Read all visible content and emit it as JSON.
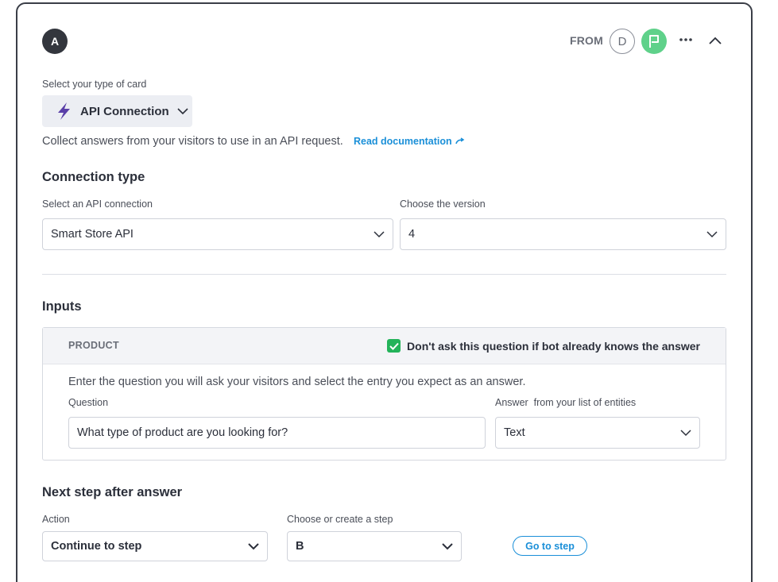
{
  "step": {
    "badge": "A"
  },
  "header": {
    "from_label": "FROM",
    "from_steps": [
      "D"
    ]
  },
  "card_type": {
    "label": "Select your type of card",
    "selected": "API Connection",
    "description": "Collect answers from your visitors to use in an API request.",
    "doc_link": "Read documentation"
  },
  "connection": {
    "title": "Connection type",
    "api_label": "Select an API connection",
    "api_value": "Smart Store API",
    "version_label": "Choose the version",
    "version_value": "4"
  },
  "inputs": {
    "title": "Inputs",
    "entity": "PRODUCT",
    "skip_checkbox_label": "Don't ask this question if bot already knows the answer",
    "skip_checked": true,
    "description": "Enter the question you will ask your visitors and select the entry you expect as an answer.",
    "question_label": "Question",
    "question_value": "What type of product are you looking for?",
    "answer_label_main": "Answer",
    "answer_label_sub": "from your list of entities",
    "answer_value": "Text"
  },
  "next_step": {
    "title": "Next step after answer",
    "action_label": "Action",
    "action_value": "Continue to step",
    "step_label": "Choose or create a step",
    "step_value": "B",
    "go_button": "Go to step"
  },
  "colors": {
    "accent": "#1a8fd8",
    "check_green": "#23b35a",
    "flag_green": "#5fd18a",
    "badge_dark": "#33363d"
  }
}
